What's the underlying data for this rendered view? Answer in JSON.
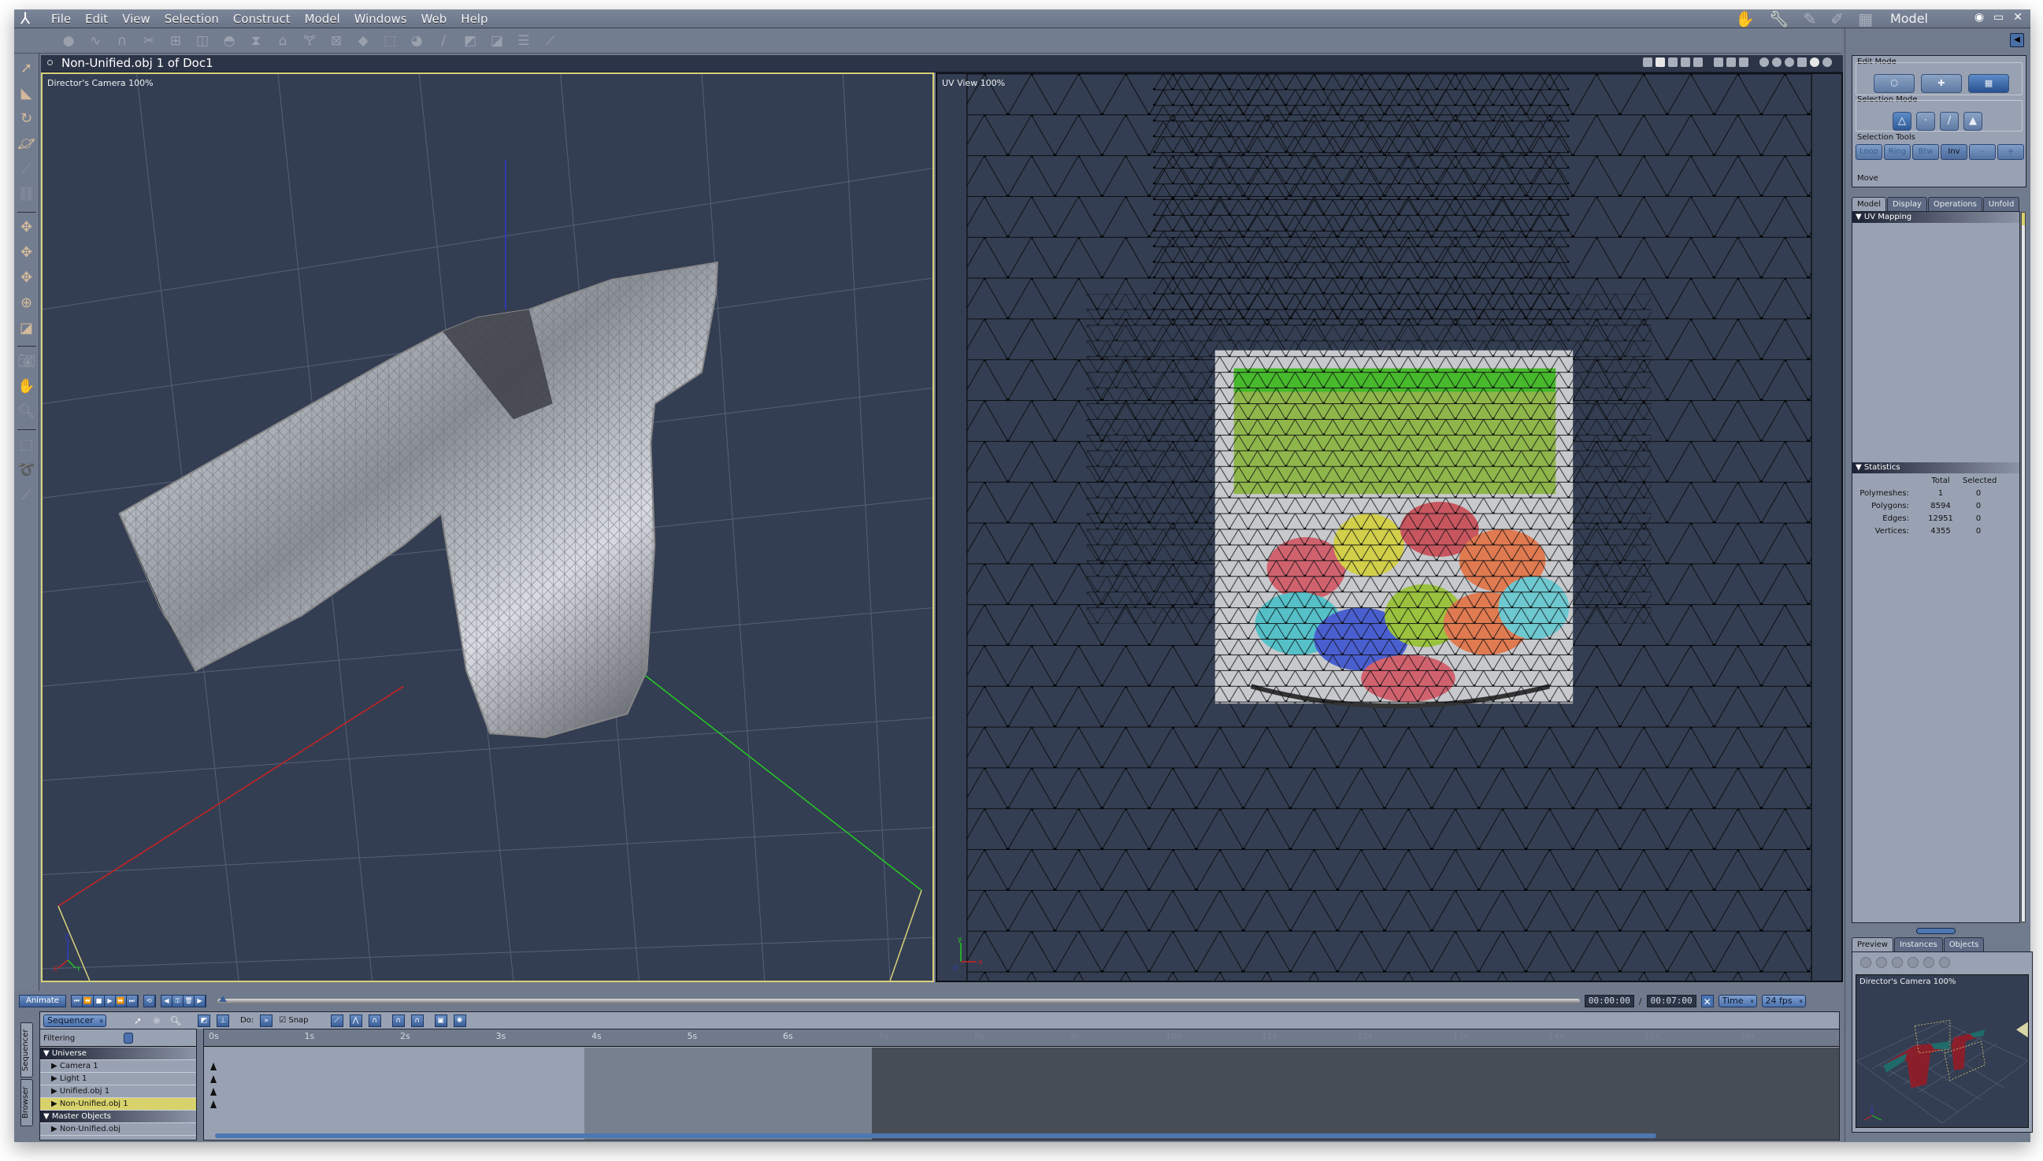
{
  "app": {
    "menu": [
      "File",
      "Edit",
      "View",
      "Selection",
      "Construct",
      "Model",
      "Windows",
      "Web",
      "Help"
    ],
    "room_label": "Model",
    "room_icons": [
      "hand-icon",
      "wrench-icon",
      "pencil-icon",
      "brush-icon",
      "film-icon"
    ],
    "window_controls": [
      "eye-icon",
      "maximize-icon",
      "close-icon"
    ]
  },
  "toolbar": {
    "icons": [
      "sphere-primitive-icon",
      "bezier-curve-icon",
      "magnet-icon",
      "scissors-icon",
      "add-point-icon",
      "bounding-box-icon",
      "dome-icon",
      "lathe-icon",
      "extrude-icon",
      "glass-icon",
      "cross-box-icon",
      "cube-shade-icon",
      "paper-bag-icon",
      "ball-icon",
      "brush-tool-icon",
      "bend-icon",
      "twist-icon",
      "align-icon",
      "taper-icon"
    ]
  },
  "document": {
    "title": "Non-Unified.obj 1 of Doc1"
  },
  "viewports": {
    "left_label": "Director's Camera 100%",
    "right_label": "UV View 100%"
  },
  "tools": {
    "icons": [
      "arrow-select-icon",
      "pointer-icon",
      "rotate-icon",
      "orbit-icon",
      "microphone-icon",
      "link-icon",
      "move-xz-icon",
      "move-xy-icon",
      "move-yz-icon",
      "universal-move-icon",
      "room-icon",
      "camera-icon",
      "hand-icon",
      "zoom-icon",
      "rect-select-icon",
      "lasso-icon",
      "paintbrush-select-icon"
    ]
  },
  "right_panel": {
    "edit_mode_label": "Edit Mode",
    "selection_mode_label": "Selection Mode",
    "selection_tools_label": "Selection Tools",
    "selection_tools": [
      "Loop",
      "Ring",
      "Btw",
      "Inv",
      "-",
      "+"
    ],
    "move_label": "Move",
    "tabs": [
      "Model",
      "Display",
      "Operations",
      "Unfold"
    ],
    "uv_mapping_label": "UV Mapping",
    "statistics": {
      "label": "Statistics",
      "col_total": "Total",
      "col_selected": "Selected",
      "rows": [
        {
          "label": "Polymeshes:",
          "total": "1",
          "selected": "0"
        },
        {
          "label": "Polygons:",
          "total": "8594",
          "selected": "0"
        },
        {
          "label": "Edges:",
          "total": "12951",
          "selected": "0"
        },
        {
          "label": "Vertices:",
          "total": "4355",
          "selected": "0"
        }
      ]
    },
    "preview_tabs": [
      "Preview",
      "Instances",
      "Objects"
    ],
    "preview_label": "Director's Camera 100%"
  },
  "timeline": {
    "animate_label": "Animate",
    "current_time": "00:00:00",
    "end_time": "00:07:00",
    "time_mode": "Time",
    "fps": "24 fps",
    "sequencer_dropdown": "Sequencer",
    "do_label": "Do:",
    "snap_label": "Snap",
    "filtering_label": "Filtering",
    "side_tabs": [
      "Sequencer",
      "Browser"
    ],
    "ruler_labels": [
      "0s",
      "1s",
      "2s",
      "3s",
      "4s",
      "5s",
      "6s",
      "7s",
      "8s",
      "9s",
      "10s",
      "11s",
      "12s",
      "13s",
      "14s",
      "15s",
      "16s",
      "17"
    ],
    "tree": [
      {
        "label": "Universe",
        "type": "header"
      },
      {
        "label": "Camera 1",
        "type": "child"
      },
      {
        "label": "Light 1",
        "type": "child"
      },
      {
        "label": "Unified.obj 1",
        "type": "child"
      },
      {
        "label": "Non-Unified.obj 1",
        "type": "selected"
      },
      {
        "label": "Master Objects",
        "type": "header"
      },
      {
        "label": "Non-Unified.obj",
        "type": "child"
      }
    ]
  }
}
